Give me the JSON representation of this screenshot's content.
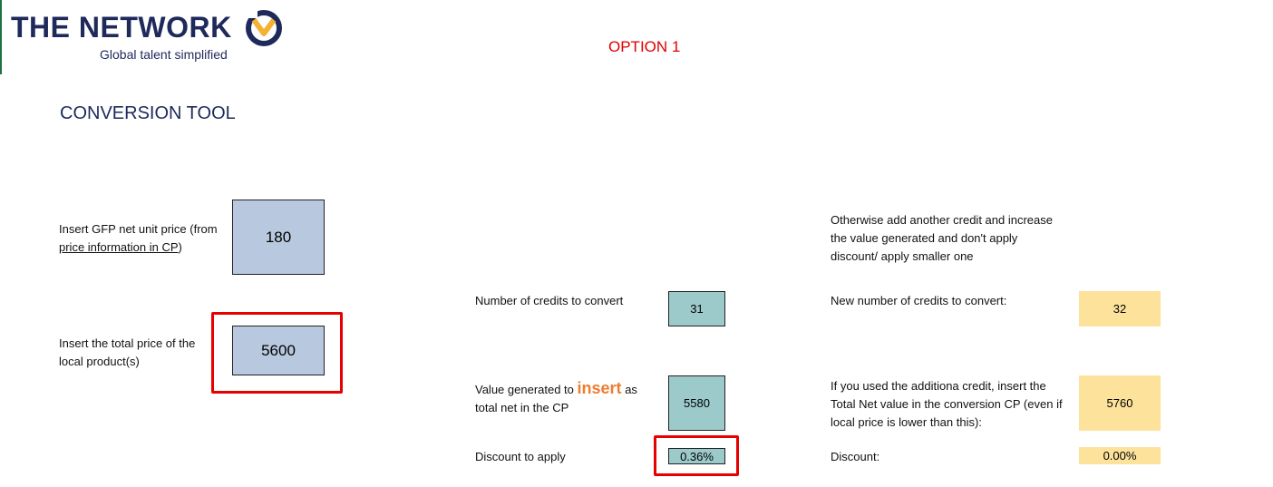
{
  "logo": {
    "name": "THE NETWORK",
    "tagline": "Global talent simplified"
  },
  "option_label": "OPTION 1",
  "heading": "CONVERSION TOOL",
  "left": {
    "gfp_label_a": "Insert GFP net unit price (from",
    "gfp_label_link": "price information in CP",
    "gfp_label_close": ")",
    "gfp_value": "180",
    "total_label_a": "Insert the total price of the",
    "total_label_b": "local product(s)",
    "total_value": "5600"
  },
  "middle": {
    "credits_label": "Number of credits to convert",
    "credits_value": "31",
    "value_label_a": "Value generated to",
    "value_label_insert": "insert",
    "value_label_b": "as",
    "value_label_c": "total net in the CP",
    "value_value": "5580",
    "discount_label": "Discount to apply",
    "discount_value": "0.36%"
  },
  "right": {
    "otherwise_a": "Otherwise add another credit and increase",
    "otherwise_b": "the value generated and don't apply",
    "otherwise_c": "discount/ apply smaller one",
    "new_credits_label": "New number of credits to convert:",
    "new_credits_value": "32",
    "additional_a": "If you used the additiona credit, insert the",
    "additional_b": "Total Net value in the conversion CP (even if",
    "additional_c": "local price is lower than this):",
    "additional_value": "5760",
    "discount_label": "Discount:",
    "discount_value": "0.00%"
  },
  "colors": {
    "brand_navy": "#1d2a5b",
    "option_red": "#e00000",
    "highlight_red": "#e60000",
    "input_blue": "#b8c8de",
    "calc_teal": "#9ccacb",
    "result_yellow": "#fde29c",
    "insert_orange": "#ed7d31"
  },
  "icons": {
    "logo_mark": "chevron-circle-logo-icon"
  }
}
